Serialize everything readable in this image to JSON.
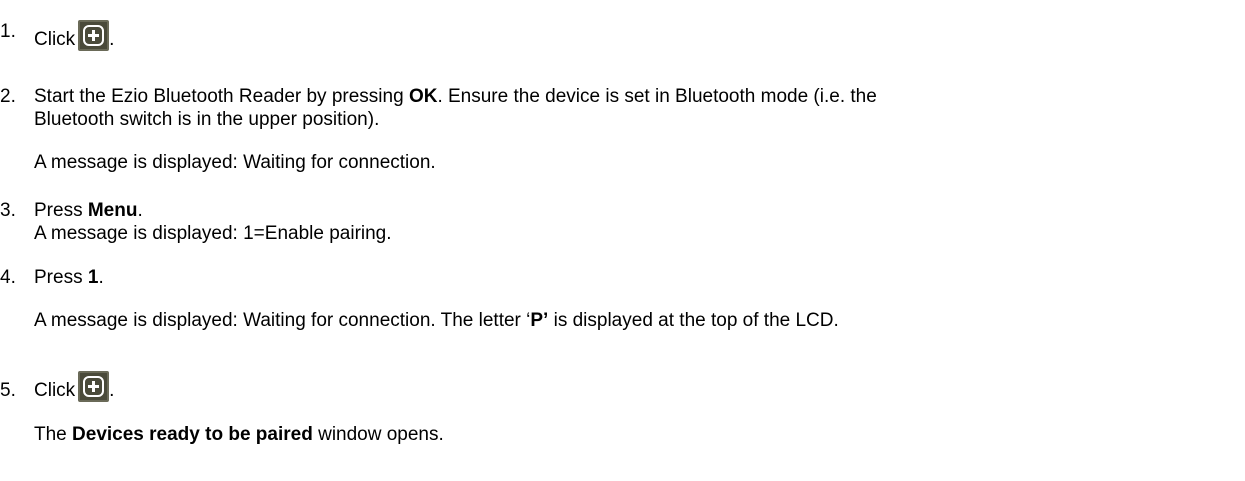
{
  "steps": [
    {
      "num": "1.",
      "text": "Click",
      "icon": "add-plus-icon",
      "tail": "."
    },
    {
      "num": "2.",
      "pre": "Start the Ezio Bluetooth Reader by pressing ",
      "bold": "OK",
      "post": ". Ensure the device is set in Bluetooth mode (i.e. the",
      "line2": "Bluetooth switch is in the upper position).",
      "message": "A message is displayed: Waiting for connection."
    },
    {
      "num": "3.",
      "pre": "Press ",
      "bold": "Menu",
      "post": ".",
      "line2": "A message is displayed: 1=Enable pairing."
    },
    {
      "num": "4.",
      "pre": "Press ",
      "bold": "1",
      "post": ".",
      "message_pre": "A message is displayed: Waiting for connection. The letter ‘",
      "message_bold": "P’",
      "message_post": " is displayed at the top of the LCD."
    },
    {
      "num": "5.",
      "text": "Click",
      "icon": "add-plus-icon",
      "tail": ".",
      "message_pre": "The ",
      "message_bold": "Devices ready to be paired",
      "message_post": " window opens."
    }
  ],
  "colors": {
    "icon_bg": "#4a4a3a",
    "icon_fg": "#ffffff",
    "text": "#000000"
  }
}
